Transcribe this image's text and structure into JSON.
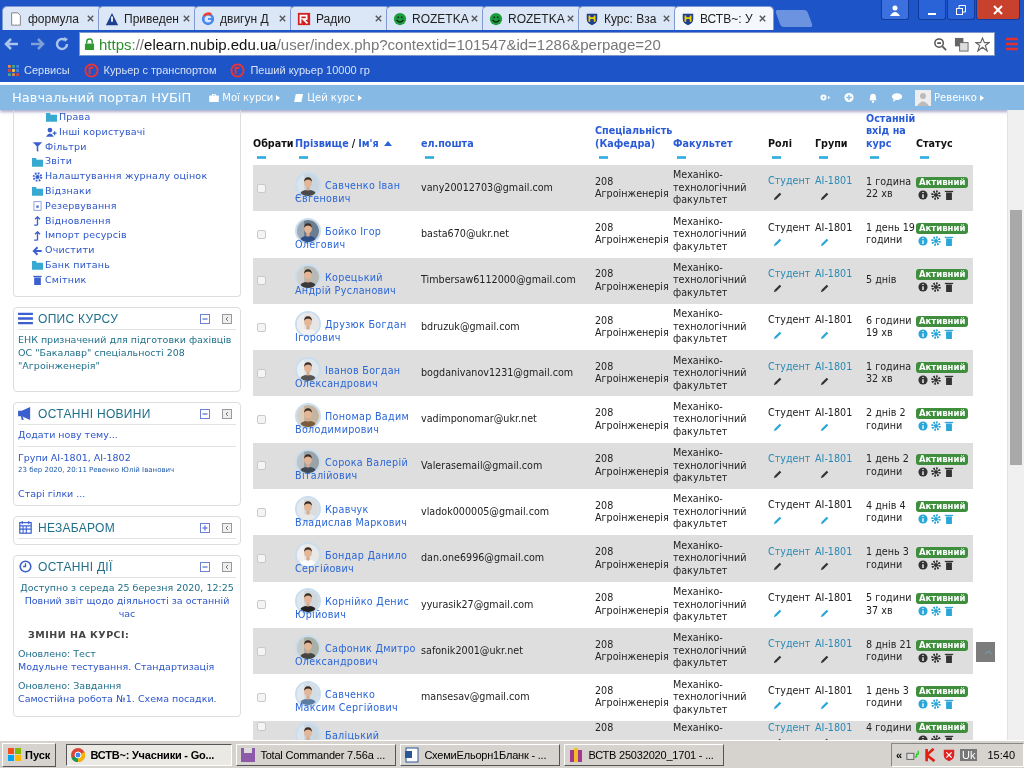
{
  "browser": {
    "tabs": [
      {
        "title": "формула",
        "selected": false
      },
      {
        "title": "Приведен",
        "selected": false
      },
      {
        "title": "двигун Д",
        "selected": false
      },
      {
        "title": "Радио",
        "selected": false
      },
      {
        "title": "ROZETKA",
        "selected": false
      },
      {
        "title": "ROZETKA",
        "selected": false
      },
      {
        "title": "Курс: Вза",
        "selected": false
      },
      {
        "title": "ВСТВ~: У",
        "selected": true
      }
    ],
    "url": {
      "scheme": "https",
      "separator": "://",
      "host": "elearn.nubip.edu.ua",
      "path": "/user/index.php?contextid=101547&id=1286&perpage=20"
    },
    "bookmarks": [
      "Сервисы",
      "Курьер с транспортом",
      "Пеший курьер 10000 гр"
    ]
  },
  "site": {
    "brand": "Навчальний портал НУБіП",
    "menus": [
      "Мої курси",
      "Цей курс"
    ],
    "user": "Ревенко"
  },
  "sidebar": {
    "nav": [
      {
        "children": [
          {
            "label": "Права"
          },
          {
            "label": "Інші користувачі"
          }
        ]
      },
      {
        "label": "Фільтри"
      },
      {
        "label": "Звіти"
      },
      {
        "label": "Налаштування журналу оцінок"
      },
      {
        "label": "Відзнаки"
      },
      {
        "label": "Резервування"
      },
      {
        "label": "Відновлення"
      },
      {
        "label": "Імпорт ресурсів"
      },
      {
        "label": "Очистити"
      },
      {
        "label": "Банк питань"
      },
      {
        "label": "Смітник"
      }
    ],
    "blocks": [
      {
        "kind": "description",
        "title": "ОПИС КУРСУ",
        "collapsed": false,
        "text": "ЕНК призначений для підготовки фахівців ОС \"Бакалавр\" спеціальності 208 \"Агроінженерія\""
      },
      {
        "kind": "news",
        "title": "ОСТАННІ НОВИНИ",
        "collapsed": false,
        "add_link": "Додати нову тему...",
        "posts": [
          {
            "title": "Групи AI-1801, AI-1802",
            "meta": "23 бер 2020, 20:11 Ревенко Юлій Іванович"
          }
        ],
        "older_link": "Старі гілки ..."
      },
      {
        "kind": "upcoming",
        "title": "НЕЗАБАРОМ",
        "collapsed": true
      },
      {
        "kind": "activity",
        "title": "ОСТАННІ ДІЇ",
        "collapsed": false,
        "since": "Доступно з середа 25 березня 2020, 12:25",
        "report_link": "Повний звіт щодо діяльності за останній час",
        "changes_heading": "ЗМІНИ НА КУРСІ:",
        "changes": [
          {
            "label": "Оновлено: Тест",
            "link": "Модульне тестування. Стандартизація"
          },
          {
            "label": "Оновлено: Завдання",
            "link": "Самостійна робота №1. Схема посадки."
          }
        ]
      }
    ]
  },
  "table": {
    "columns": [
      {
        "label": "Обрати",
        "link": false
      },
      {
        "label": "Прізвище",
        "link": true,
        "separator": "/",
        "label_2": "Ім'я",
        "sorted": true
      },
      {
        "label": "ел.пошта",
        "link": true
      },
      {
        "label": "Спеціальність (Кафедра)",
        "link": true
      },
      {
        "label": "Факультет",
        "link": true
      },
      {
        "label": "Ролі",
        "link": false
      },
      {
        "label": "Групи",
        "link": false
      },
      {
        "label": "Останній вхід на курс",
        "link": true
      },
      {
        "label": "Статус",
        "link": false
      }
    ],
    "rows": [
      {
        "shaded": true,
        "checked": false,
        "name": "Савченко Іван Євгенович",
        "email": "vany20012703@gmail.com",
        "specialty": "208 Агроінженерія",
        "faculty": "Механіко-технологічний факультет",
        "role": "Студент",
        "group": "AI-1801",
        "last_access": "1 година 22 хв",
        "status": "Активний"
      },
      {
        "shaded": false,
        "checked": false,
        "name": "Бойко Ігор Олегович",
        "email": "basta670@ukr.net",
        "specialty": "208 Агроінженерія",
        "faculty": "Механіко-технологічний факультет",
        "role": "Студент",
        "group": "AI-1801",
        "last_access": "1 день 19 години",
        "status": "Активний"
      },
      {
        "shaded": true,
        "checked": false,
        "name": "Корецький Андрій Русланович",
        "email": "Timbersaw6112000@gmail.com",
        "specialty": "208 Агроінженерія",
        "faculty": "Механіко-технологічний факультет",
        "role": "Студент",
        "group": "AI-1801",
        "last_access": "5 днів",
        "status": "Активний"
      },
      {
        "shaded": false,
        "checked": false,
        "name": "Друзюк Богдан Ігорович",
        "email": "bdruzuk@gmail.com",
        "specialty": "208 Агроінженерія",
        "faculty": "Механіко-технологічний факультет",
        "role": "Студент",
        "group": "AI-1801",
        "last_access": "6 години 19 хв",
        "status": "Активний"
      },
      {
        "shaded": true,
        "checked": false,
        "name": "Іванов Богдан Олександрович",
        "email": "bogdanivanov1231@gmail.com",
        "specialty": "208 Агроінженерія",
        "faculty": "Механіко-технологічний факультет",
        "role": "Студент",
        "group": "AI-1801",
        "last_access": "1 година 32 хв",
        "status": "Активний"
      },
      {
        "shaded": false,
        "checked": false,
        "name": "Пономар Вадим Володимирович",
        "email": "vadimponomar@ukr.net",
        "specialty": "208 Агроінженерія",
        "faculty": "Механіко-технологічний факультет",
        "role": "Студент",
        "group": "AI-1801",
        "last_access": "2 днів 2 години",
        "status": "Активний"
      },
      {
        "shaded": true,
        "checked": false,
        "name": "Сорока Валерій Віталійович",
        "email": "Valerasemail@gmail.com",
        "specialty": "208 Агроінженерія",
        "faculty": "Механіко-технологічний факультет",
        "role": "Студент",
        "group": "AI-1801",
        "last_access": "1 день 2 години",
        "status": "Активний"
      },
      {
        "shaded": false,
        "checked": false,
        "name": "Кравчук Владислав Маркович",
        "email": "vladok000005@gmail.com",
        "specialty": "208 Агроінженерія",
        "faculty": "Механіко-технологічний факультет",
        "role": "Студент",
        "group": "AI-1801",
        "last_access": "4 днів 4 години",
        "status": "Активний"
      },
      {
        "shaded": true,
        "checked": false,
        "name": "Бондар Данило Сергійович",
        "email": "dan.one6996@gmail.com",
        "specialty": "208 Агроінженерія",
        "faculty": "Механіко-технологічний факультет",
        "role": "Студент",
        "group": "AI-1801",
        "last_access": "1 день 3 години",
        "status": "Активний"
      },
      {
        "shaded": false,
        "checked": false,
        "name": "Корнійко Денис Юрійович",
        "email": "yyurasik27@gmail.com",
        "specialty": "208 Агроінженерія",
        "faculty": "Механіко-технологічний факультет",
        "role": "Студент",
        "group": "AI-1801",
        "last_access": "5 години 37 хв",
        "status": "Активний"
      },
      {
        "shaded": true,
        "checked": false,
        "name": "Сафоник Дмитро Олександрович",
        "email": "safonik2001@ukr.net",
        "specialty": "208 Агроінженерія",
        "faculty": "Механіко-технологічний факультет",
        "role": "Студент",
        "group": "AI-1801",
        "last_access": "8 днів 21 години",
        "status": "Активний"
      },
      {
        "shaded": false,
        "checked": false,
        "name": "Савченко Максим Сергійович",
        "email": "mansesav@gmail.com",
        "specialty": "208 Агроінженерія",
        "faculty": "Механіко-технологічний факультет",
        "role": "Студент",
        "group": "AI-1801",
        "last_access": "1 день 3 години",
        "status": "Активний"
      },
      {
        "shaded": true,
        "checked": false,
        "name": "Баліцький",
        "specialty": "208",
        "faculty": "Механіко-",
        "role": "Студент",
        "group": "AI-1801",
        "last_access": "4 години",
        "status": "Активний"
      }
    ]
  },
  "taskbar": {
    "start": "Пуск",
    "tasks": [
      {
        "label": "ВСТВ~: Учасники - Go...",
        "selected": true
      },
      {
        "label": "Total Commander 7.56a ...",
        "selected": false
      },
      {
        "label": "СхемиЕльорн1Бланк - ...",
        "selected": false
      },
      {
        "label": "ВСТВ 25032020_1701 - ...",
        "selected": false
      }
    ],
    "tray_toggle": "«",
    "language": "Uk",
    "clock": "15:40"
  }
}
